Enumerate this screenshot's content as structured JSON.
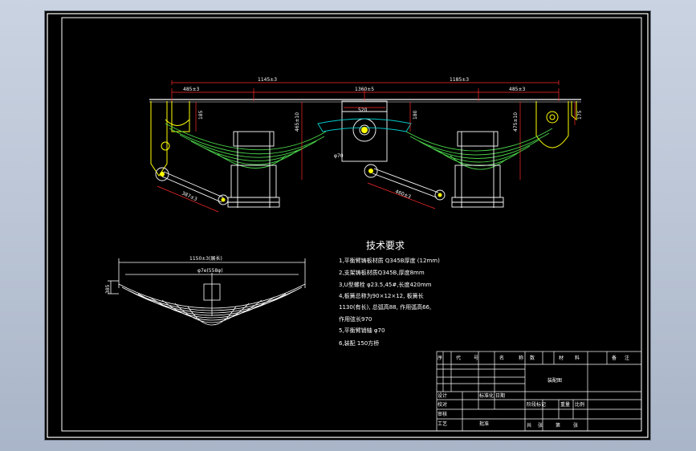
{
  "app": {
    "name": "CAD drawing viewer",
    "colors": {
      "background": "#000000",
      "frame": "#ffffff",
      "spring": "#4bd84b",
      "bracket": "#ffff00",
      "dimension": "#ff2a2a",
      "balance_arm": "#00c8c8"
    }
  },
  "assembly": {
    "dims": {
      "d1": "485±3",
      "d2": "1145±3",
      "d3": "1360±5",
      "d4": "1185±3",
      "d5": "485±3",
      "d6": "185",
      "d7": "465±10",
      "d8": "520",
      "d9": "180",
      "d10": "475±10",
      "d11": "175",
      "d12": "φ70",
      "d13": "387±3",
      "d14": "460±3"
    }
  },
  "spring_view": {
    "len": "1150±3(展长)",
    "chord": "φ7e(558φ)",
    "height": "385"
  },
  "notes": {
    "title": "技术要求",
    "lines": [
      "1,平衡臂铸板材质 Q345B厚度 (12mm)",
      "2,支架铸板材质Q345B,厚度8mm",
      "3,U型螺栓 φ23.5,45#,长度420mm",
      "4,板簧总称为90×12×12, 板簧长",
      "1130(有长), 总弧高88, 作用弧高66,",
      "作用弦长970",
      "5,平衡臂销轴 φ70",
      "6,装配 150方桥"
    ]
  },
  "title_block": {
    "h1": "序",
    "h2": "代",
    "h3": "号",
    "h4": "名",
    "h5": "称",
    "h6": "数",
    "h7": "材",
    "h8": "料",
    "h9": "备",
    "h10": "注",
    "drawing_name": "装配图",
    "r1": "设计",
    "r2": "校对",
    "r3": "审核",
    "r4": "工艺",
    "r5": "标准化",
    "r6": "日期",
    "stage": "阶段标记",
    "weight": "重量",
    "scale": "比例",
    "sheet1": "共",
    "sheet2": "张",
    "sheet3": "第",
    "sheet4": "张",
    "approve": "批准"
  }
}
